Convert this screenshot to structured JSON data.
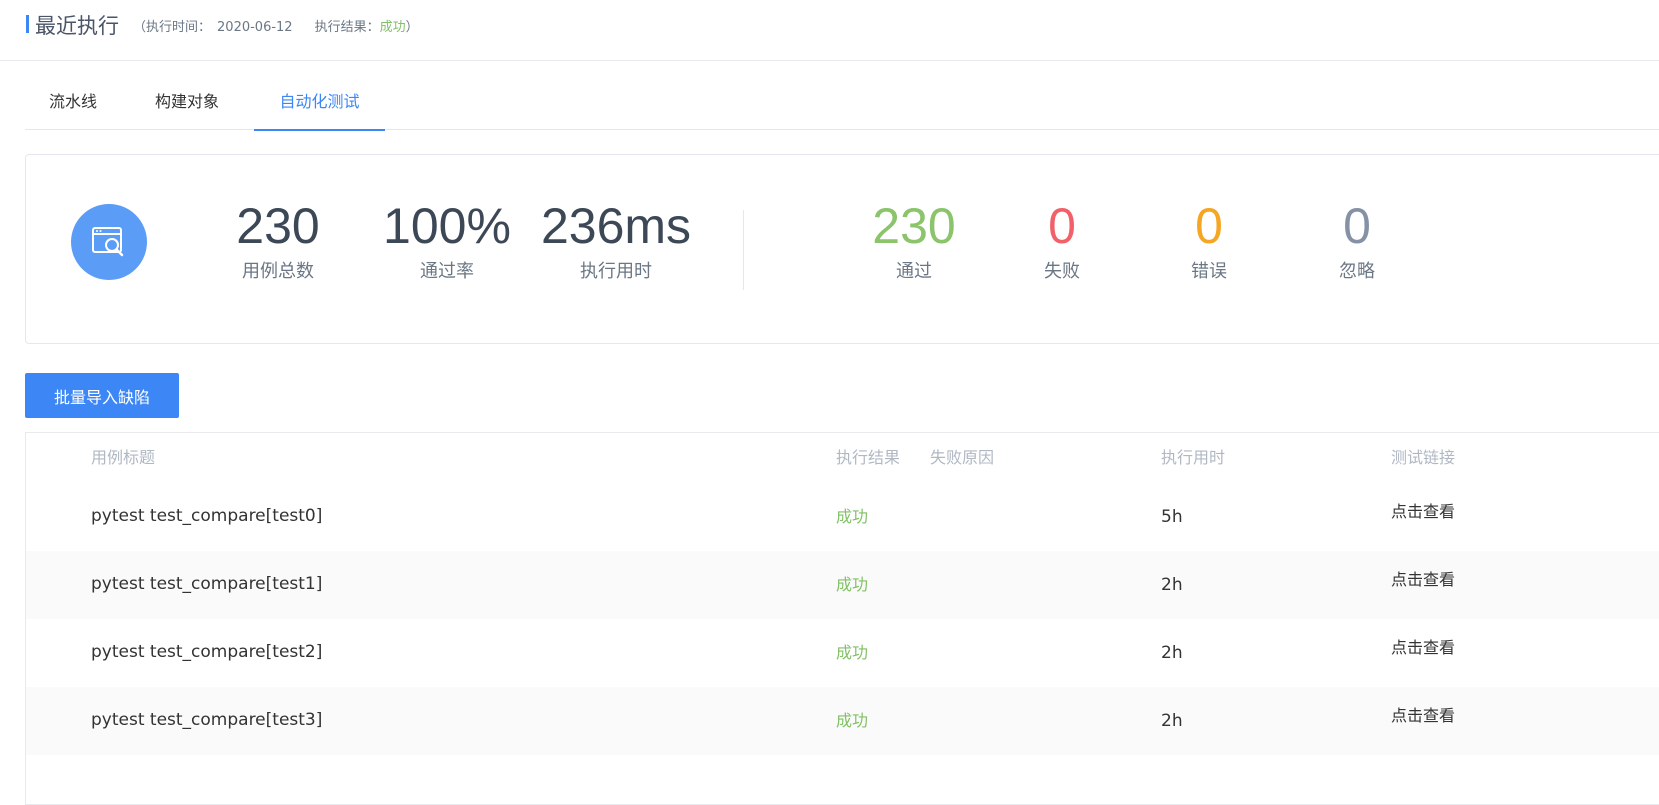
{
  "header": {
    "title": "最近执行",
    "open_paren": "（",
    "exec_time_label": "执行时间：",
    "exec_time_value": "2020-06-12",
    "exec_result_label": "执行结果：",
    "exec_result_value": "成功",
    "close_paren": "）"
  },
  "tabs": [
    {
      "label": "流水线"
    },
    {
      "label": "构建对象"
    },
    {
      "label": "自动化测试",
      "active": true
    }
  ],
  "summary": {
    "icon": "browser-search-icon",
    "stats": [
      {
        "value": "230",
        "label": "用例总数"
      },
      {
        "value": "100%",
        "label": "通过率"
      },
      {
        "value": "236ms",
        "label": "执行用时"
      }
    ],
    "results": [
      {
        "value": "230",
        "label": "通过",
        "color": "#8bc46b"
      },
      {
        "value": "0",
        "label": "失败",
        "color": "#f2616a"
      },
      {
        "value": "0",
        "label": "错误",
        "color": "#f5a623"
      },
      {
        "value": "0",
        "label": "忽略",
        "color": "#8592a6"
      }
    ]
  },
  "actions": {
    "import_defects_label": "批量导入缺陷"
  },
  "table": {
    "columns": {
      "title": "用例标题",
      "result": "执行结果",
      "fail_reason": "失败原因",
      "duration": "执行用时",
      "link": "测试链接"
    },
    "rows": [
      {
        "title": "pytest test_compare[test0]",
        "result": "成功",
        "fail_reason": "",
        "duration": "5h",
        "link": "点击查看"
      },
      {
        "title": "pytest test_compare[test1]",
        "result": "成功",
        "fail_reason": "",
        "duration": "2h",
        "link": "点击查看"
      },
      {
        "title": "pytest test_compare[test2]",
        "result": "成功",
        "fail_reason": "",
        "duration": "2h",
        "link": "点击查看"
      },
      {
        "title": "pytest test_compare[test3]",
        "result": "成功",
        "fail_reason": "",
        "duration": "2h",
        "link": "点击查看"
      }
    ]
  }
}
